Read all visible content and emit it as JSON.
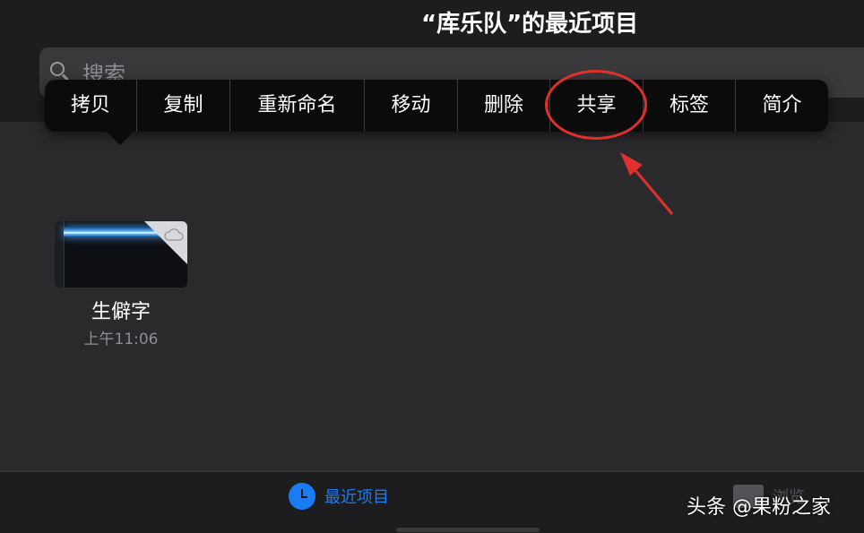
{
  "header": {
    "title": "“库乐队”的最近项目"
  },
  "search": {
    "placeholder": "搜索"
  },
  "context_menu": {
    "items": [
      {
        "label": "拷贝",
        "name": "copy"
      },
      {
        "label": "复制",
        "name": "duplicate"
      },
      {
        "label": "重新命名",
        "name": "rename"
      },
      {
        "label": "移动",
        "name": "move"
      },
      {
        "label": "删除",
        "name": "delete"
      },
      {
        "label": "共享",
        "name": "share"
      },
      {
        "label": "标签",
        "name": "tags"
      },
      {
        "label": "简介",
        "name": "info"
      }
    ],
    "highlighted": "共享"
  },
  "files": [
    {
      "name": "生僻字",
      "time": "上午11:06"
    }
  ],
  "tab_bar": {
    "recents": {
      "label": "最近项目",
      "icon": "clock-icon"
    },
    "browse": {
      "label": "浏览",
      "icon": "folder-icon"
    }
  },
  "watermark": "头条 @果粉之家",
  "colors": {
    "accent": "#1a7cf5",
    "annotation": "#e0302d",
    "menu_bg": "#0b0b0c",
    "background": "#2a2a2c"
  }
}
